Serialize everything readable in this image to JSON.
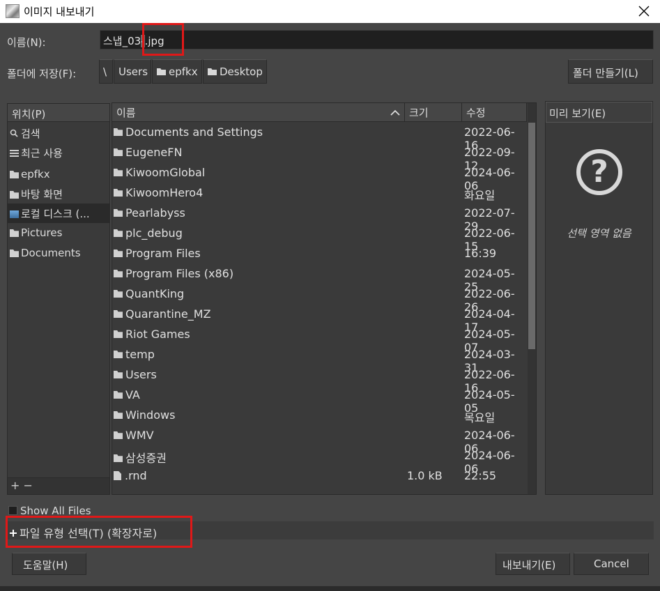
{
  "window": {
    "title": "이미지 내보내기"
  },
  "name_row": {
    "label": "이름(N):",
    "value_pre": "스냅_03",
    "value_sel": "-",
    "value_post": ".jpg"
  },
  "folder_row": {
    "label": "폴더에 저장(F):",
    "path": [
      "\\",
      "Users",
      "epfkx",
      "Desktop"
    ],
    "create_folder": "폴더 만들기(L)"
  },
  "places": {
    "header": "위치(P)",
    "items": [
      {
        "label": "검색",
        "icon": "search-icon"
      },
      {
        "label": "최근 사용",
        "icon": "recent-icon"
      },
      {
        "label": "epfkx",
        "icon": "folder-icon"
      },
      {
        "label": "바탕 화면",
        "icon": "folder-icon"
      },
      {
        "label": "로컬 디스크 (...",
        "icon": "drive-icon"
      },
      {
        "label": "Pictures",
        "icon": "folder-icon"
      },
      {
        "label": "Documents",
        "icon": "folder-icon"
      }
    ],
    "footer": "+ −"
  },
  "filelist": {
    "columns": {
      "name": "이름",
      "size": "크기",
      "modified": "수정"
    },
    "rows": [
      {
        "name": "Documents and Settings",
        "size": "",
        "modified": "2022-06-16",
        "type": "folder"
      },
      {
        "name": "EugeneFN",
        "size": "",
        "modified": "2022-09-12",
        "type": "folder"
      },
      {
        "name": "KiwoomGlobal",
        "size": "",
        "modified": "2024-06-06",
        "type": "folder"
      },
      {
        "name": "KiwoomHero4",
        "size": "",
        "modified": "화요일",
        "type": "folder"
      },
      {
        "name": "Pearlabyss",
        "size": "",
        "modified": "2022-07-29",
        "type": "folder"
      },
      {
        "name": "plc_debug",
        "size": "",
        "modified": "2022-06-15",
        "type": "folder"
      },
      {
        "name": "Program Files",
        "size": "",
        "modified": "16:39",
        "type": "folder"
      },
      {
        "name": "Program Files (x86)",
        "size": "",
        "modified": "2024-05-25",
        "type": "folder"
      },
      {
        "name": "QuantKing",
        "size": "",
        "modified": "2022-06-26",
        "type": "folder"
      },
      {
        "name": "Quarantine_MZ",
        "size": "",
        "modified": "2024-04-17",
        "type": "folder"
      },
      {
        "name": "Riot Games",
        "size": "",
        "modified": "2024-05-07",
        "type": "folder"
      },
      {
        "name": "temp",
        "size": "",
        "modified": "2024-03-31",
        "type": "folder"
      },
      {
        "name": "Users",
        "size": "",
        "modified": "2022-06-16",
        "type": "folder"
      },
      {
        "name": "VA",
        "size": "",
        "modified": "2024-05-05",
        "type": "folder"
      },
      {
        "name": "Windows",
        "size": "",
        "modified": "목요일",
        "type": "folder"
      },
      {
        "name": "WMV",
        "size": "",
        "modified": "2024-06-06",
        "type": "folder"
      },
      {
        "name": "삼성증권",
        "size": "",
        "modified": "2024-06-06",
        "type": "folder"
      },
      {
        "name": ".rnd",
        "size": "1.0 kB",
        "modified": "22:55",
        "type": "file"
      }
    ]
  },
  "preview": {
    "header": "미리 보기(E)",
    "empty": "선택 영역 없음"
  },
  "options": {
    "show_all": "Show All Files",
    "file_type": "파일 유형 선택(T) (확장자로)"
  },
  "buttons": {
    "help": "도움말(H)",
    "export": "내보내기(E)",
    "cancel": "Cancel"
  },
  "colors": {
    "highlight": "#e01818",
    "background": "#454545",
    "panel": "#3a3a3a"
  }
}
